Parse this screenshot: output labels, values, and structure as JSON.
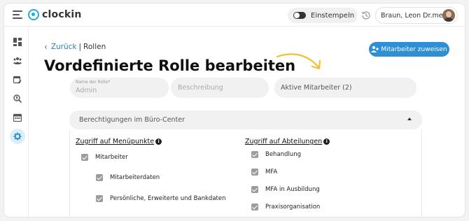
{
  "app": {
    "name": "clockin"
  },
  "header": {
    "stamp_label": "Einstempeln",
    "user_name": "Braun, Leon Dr.med."
  },
  "sidebar": {
    "items": [
      {
        "icon": "dashboard-icon",
        "active": false
      },
      {
        "icon": "team-icon",
        "active": false
      },
      {
        "icon": "calendar-edit-icon",
        "active": false
      },
      {
        "icon": "search-person-icon",
        "active": false
      },
      {
        "icon": "calendar-icon",
        "active": false
      },
      {
        "icon": "gear-icon",
        "active": true
      }
    ]
  },
  "breadcrumb": {
    "back_label": "Zurück",
    "separator": "|",
    "current": "Rollen"
  },
  "page": {
    "title": "Vordefinierte Rolle bearbeiten",
    "assign_button": "Mitarbeiter zuweisen"
  },
  "form": {
    "role_name_label": "Name der Rolle*",
    "role_name_value": "Admin",
    "description_placeholder": "Beschreibung",
    "active_employees": "Aktive Mitarbeiter (2)"
  },
  "permissions": {
    "section_title": "Berechtigungen im Büro-Center",
    "menu_access_title": "Zugriff auf Menüpunkte",
    "department_access_title": "Zugriff auf Abteilungen",
    "menu_items": [
      {
        "label": "Mitarbeiter",
        "checked": true
      },
      {
        "label": "Mitarbeiterdaten",
        "checked": true
      },
      {
        "label": "Persönliche, Erweiterte und Bankdaten",
        "checked": true
      }
    ],
    "departments": [
      {
        "label": "Behandlung",
        "checked": true
      },
      {
        "label": "MFA",
        "checked": true
      },
      {
        "label": "MFA in Ausbildung",
        "checked": true
      },
      {
        "label": "Praxisorganisation",
        "checked": true
      }
    ]
  },
  "colors": {
    "accent": "#2f8fd4",
    "link": "#2a7fc1",
    "logo": "#2aa8d8",
    "active_nav": "#dceef8"
  }
}
